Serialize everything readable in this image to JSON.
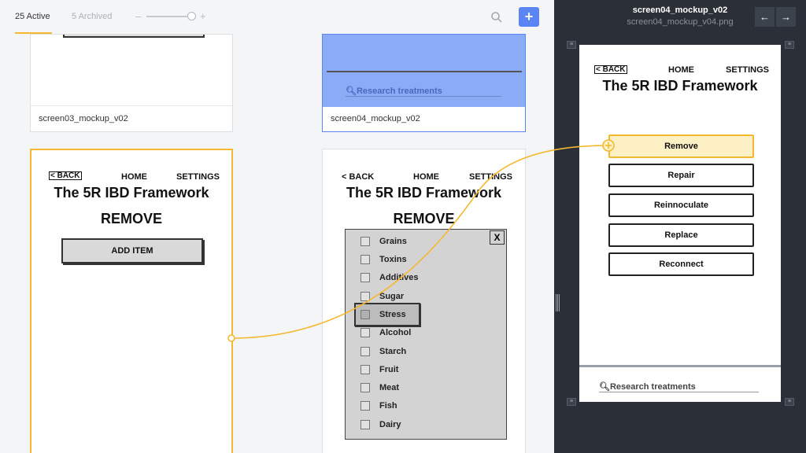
{
  "tabs": {
    "active": "25 Active",
    "archived": "5 Archived"
  },
  "zoom": {
    "minus": "–",
    "plus": "+",
    "level": 0.9
  },
  "toolbar": {
    "add_label": "+"
  },
  "cards": {
    "c1": {
      "label": "screen03_mockup_v02"
    },
    "c2": {
      "label": "screen04_mockup_v02",
      "search": "Research treatments"
    },
    "c3": {
      "back": "< BACK",
      "home": "HOME",
      "settings": "SETTINGS",
      "title": "The 5R IBD Framework",
      "heading": "REMOVE",
      "button": "ADD ITEM"
    },
    "c4": {
      "back": "< BACK",
      "home": "HOME",
      "settings": "SETTINGS",
      "title": "The 5R IBD Framework",
      "heading": "REMOVE",
      "close": "X",
      "items": [
        "Grains",
        "Toxins",
        "Additives",
        "Sugar",
        "Stress",
        "Alcohol",
        "Starch",
        "Fruit",
        "Meat",
        "Fish",
        "Dairy"
      ]
    }
  },
  "panel": {
    "title": "screen04_mockup_v02",
    "subtitle": "screen04_mockup_v04.png",
    "prev": "←",
    "next": "→",
    "phone": {
      "back": "< BACK",
      "home": "HOME",
      "settings": "SETTINGS",
      "title": "The 5R IBD Framework",
      "buttons": [
        "Remove",
        "Repair",
        "Reinnoculate",
        "Replace",
        "Reconnect"
      ],
      "search": "Research treatments"
    }
  },
  "colors": {
    "accent": "#f5b82e",
    "primary": "#5b84f5",
    "selection": "#8aabf5",
    "panel": "#2b3038"
  }
}
